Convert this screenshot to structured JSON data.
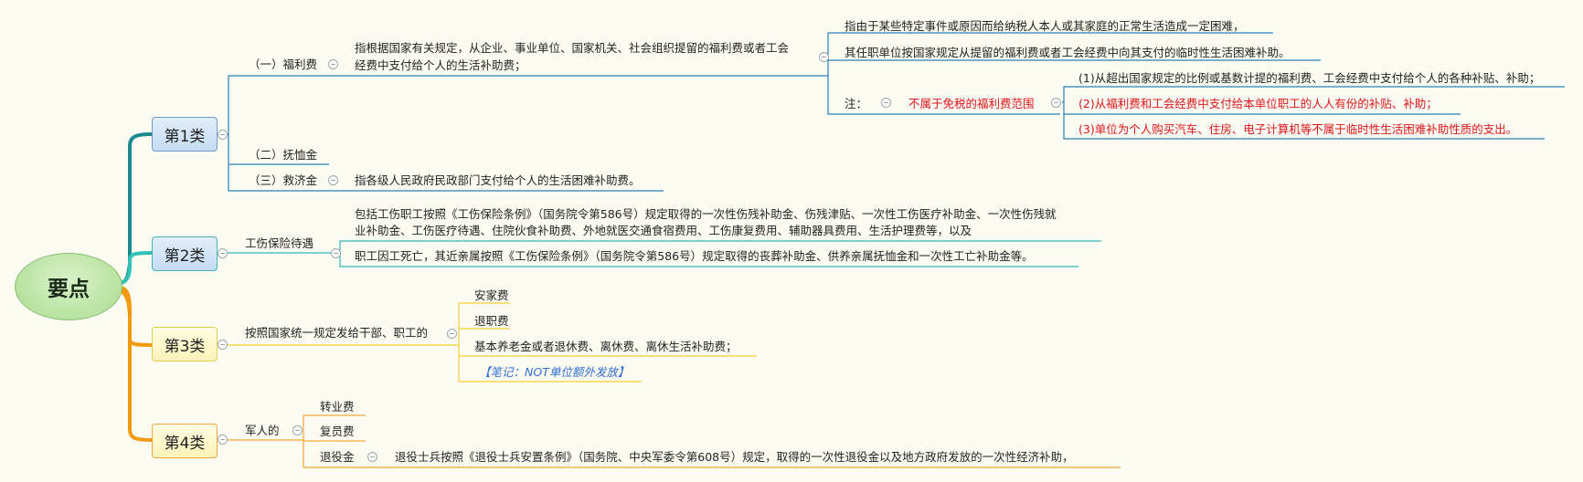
{
  "root": "要点",
  "cat1": {
    "label": "第1类",
    "b1": {
      "label": "（一）福利费",
      "desc1": "指根据国家有关规定，从企业、事业单位、国家机关、社会组织提留的福利费或者工会",
      "desc2": "经费中支付给个人的生活补助费；",
      "s1": "指由于某些特定事件或原因而给纳税人本人或其家庭的正常生活造成一定困难，",
      "s2": "其任职单位按国家规定从提留的福利费或者工会经费中向其支付的临时性生活困难补助。",
      "note_label": "注：",
      "note_title": "不属于免税的福利费范围",
      "n1": "(1)从超出国家规定的比例或基数计提的福利费、工会经费中支付给个人的各种补贴、补助；",
      "n2": "(2)从福利费和工会经费中支付给本单位职工的人人有份的补贴、补助；",
      "n3": "(3)单位为个人购买汽车、住房、电子计算机等不属于临时性生活困难补助性质的支出。"
    },
    "b2": {
      "label": "（二）抚恤金"
    },
    "b3": {
      "label": "（三）救济金",
      "desc": "指各级人民政府民政部门支付给个人的生活困难补助费。"
    }
  },
  "cat2": {
    "label": "第2类",
    "branch": "工伤保险待遇",
    "d1": "包括工伤职工按照《工伤保险条例》（国务院令第586号）规定取得的一次性伤残补助金、伤残津贴、一次性工伤医疗补助金、一次性伤残就",
    "d2": "业补助金、工伤医疗待遇、住院伙食补助费、外地就医交通食宿费用、工伤康复费用、辅助器具费用、生活护理费等，以及",
    "d3": "职工因工死亡，其近亲属按照《工伤保险条例》（国务院令第586号）规定取得的丧葬补助金、供养亲属抚恤金和一次性工亡补助金等。"
  },
  "cat3": {
    "label": "第3类",
    "branch": "按照国家统一规定发给干部、职工的",
    "items": [
      "安家费",
      "退职费",
      "基本养老金或者退休费、离休费、离休生活补助费；"
    ],
    "note": "【笔记：NOT单位额外发放】"
  },
  "cat4": {
    "label": "第4类",
    "branch": "军人的",
    "items": [
      "转业费",
      "复员费",
      "退役金"
    ],
    "retire_desc": "退役士兵按照《退役士兵安置条例》（国务院、中央军委令第608号）规定，取得的一次性退役金以及地方政府发放的一次性经济补助，"
  },
  "colors": {
    "teal": "#1a8a8f",
    "cyan": "#31c2b5",
    "orange": "#f29a12",
    "line1": "#2a7fb8",
    "line2": "#37b3b8",
    "yellow": "#f2cf36",
    "orange2": "#f2a53a"
  }
}
